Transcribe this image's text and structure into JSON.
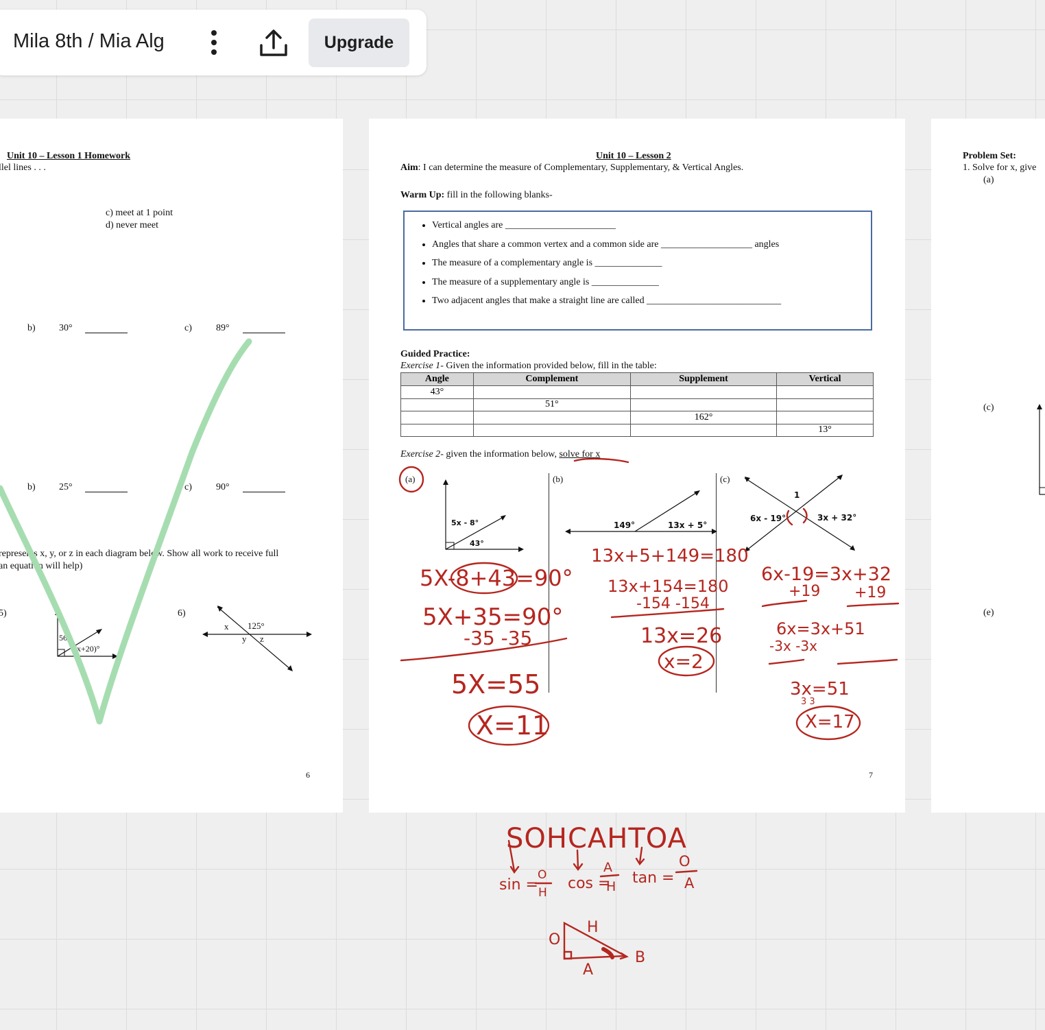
{
  "toolbar": {
    "board_title": "Mila 8th / Mia Alg",
    "upgrade_label": "Upgrade"
  },
  "left_page": {
    "title": "Unit 10 – Lesson 1 Homework",
    "q_fragment": "llel lines . . .",
    "option_c": "c)   meet at 1 point",
    "option_d": "d)   never meet",
    "row1": {
      "b_label": "b)",
      "b_value": "30°",
      "c_label": "c)",
      "c_value": "89°"
    },
    "row2": {
      "b_label": "b)",
      "b_value": "25°",
      "c_label": "c)",
      "c_value": "90°"
    },
    "directions_line1": "represents x, y, or z in each diagram below. Show all work to receive full",
    "directions_line2": "an equation will help)",
    "problem5_label": "5)",
    "problem6_label": "6)",
    "fig5": {
      "angle1": "56°",
      "angle2": "(x+20)°"
    },
    "fig6": {
      "x": "x",
      "angle": "125°",
      "y": "y",
      "z": "z"
    },
    "page_number": "6"
  },
  "middle_page": {
    "title": "Unit 10 – Lesson 2",
    "aim_label": "Aim",
    "aim_text": ": I can determine the measure of Complementary, Supplementary, & Vertical Angles.",
    "warmup_label": "Warm Up:",
    "warmup_text": " fill in the following blanks-",
    "warmup_items": [
      "Vertical angles are _______________________",
      "Angles that share a common vertex and a common side are ___________________ angles",
      "The measure of a complementary angle is ______________",
      "The measure of a supplementary angle is ______________",
      "Two adjacent angles that make a straight line are called  ____________________________"
    ],
    "guided_label": "Guided Practice:",
    "exercise1_label": "Exercise 1",
    "exercise1_text": "- Given the information provided below, fill in the table:",
    "table": {
      "headers": [
        "Angle",
        "Complement",
        "Supplement",
        "Vertical"
      ],
      "rows": [
        [
          "43°",
          "",
          "",
          ""
        ],
        [
          "",
          "51°",
          "",
          ""
        ],
        [
          "",
          "",
          "162°",
          ""
        ],
        [
          "",
          "",
          "",
          "13°"
        ]
      ]
    },
    "exercise2_label": "Exercise 2",
    "exercise2_text": "- given the information below, ",
    "exercise2_solve": "solve for x",
    "part_a": "(a)",
    "part_b": "(b)",
    "part_c": "(c)",
    "fig_a": {
      "angle1": "5x - 8°",
      "angle2": "43°"
    },
    "fig_b": {
      "angle1": "149°",
      "angle2": "13x + 5°"
    },
    "fig_c": {
      "top": "1",
      "left": "6x - 19°",
      "right": "3x + 32°"
    },
    "page_number": "7"
  },
  "right_page": {
    "title": "Problem Set:",
    "q1": "1.   Solve for x, give",
    "a": "(a)",
    "c": "(c)",
    "e": "(e)"
  },
  "handwriting": {
    "a_line1": "5X-8+43=90°",
    "a_line2": "5X+35=90°",
    "a_line3": "-35  -35",
    "a_line4": "5X=55",
    "a_answer": "X=11",
    "b_line1": "13x+5+149=180",
    "b_line2": "13x+154=180",
    "b_line3": "-154 -154",
    "b_line4": "13x=26",
    "b_answer": "x=2",
    "c_line1": "6x-19=3x+32",
    "c_line2a": "+19",
    "c_line2b": "+19",
    "c_line3": "6x=3x+51",
    "c_line4": "-3x  -3x",
    "c_line5": "3x=51",
    "c_line5d": "3      3",
    "c_answer": "X=17",
    "soh": "SOHCAHTOA",
    "sin": "sin =",
    "cos": "cos =",
    "tan": "tan =",
    "sin_num": "O",
    "sin_den": "H",
    "cos_num": "A",
    "cos_den": "H",
    "tan_num": "O",
    "tan_den": "A",
    "tri_o": "O",
    "tri_h": "H",
    "tri_a": "A",
    "tri_b": "B"
  },
  "colors": {
    "ink_red": "#b5261f",
    "highlighter_green": "#a6ddb0",
    "warmup_border": "#4a6aa0",
    "button_bg": "#e8e9ed"
  },
  "icons": [
    "more-vertical-icon",
    "share-upload-icon"
  ]
}
